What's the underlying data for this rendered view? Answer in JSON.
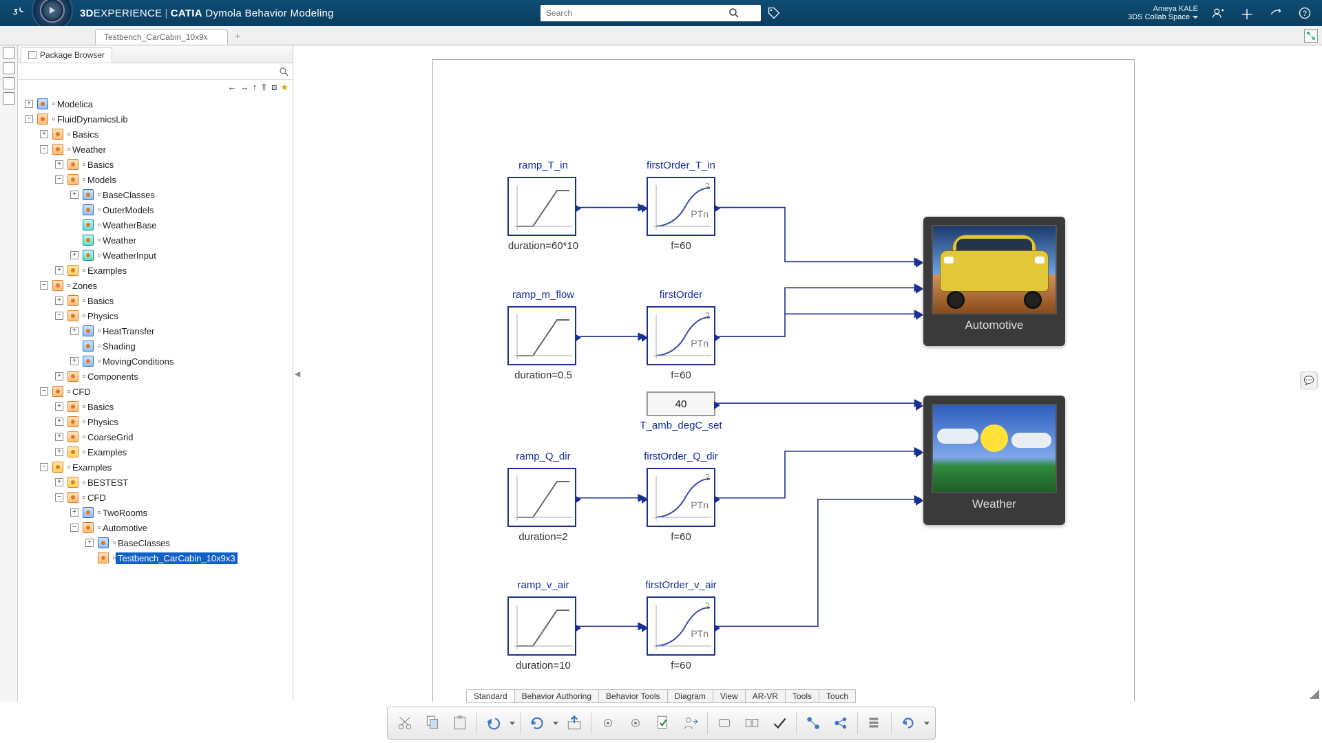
{
  "header": {
    "brand_prefix": "3D",
    "brand_main": "EXPERIENCE",
    "brand_product_bold": "CATIA",
    "brand_product_rest": " Dymola Behavior Modeling",
    "search_placeholder": "Search",
    "user_name": "Ameya KALE",
    "collab_space": "3DS Collab Space"
  },
  "tab": {
    "name": "Testbench_CarCabin_10x9x"
  },
  "sidebar": {
    "panel_title": "Package Browser",
    "root": "Modelica",
    "nodes": [
      {
        "d": 0,
        "e": "+",
        "i": "blue",
        "l": "Modelica",
        "head": true
      },
      {
        "d": 0,
        "e": "-",
        "i": "orange",
        "l": "FluidDynamicsLib"
      },
      {
        "d": 1,
        "e": "+",
        "i": "orange",
        "l": "Basics"
      },
      {
        "d": 1,
        "e": "-",
        "i": "orange",
        "l": "Weather"
      },
      {
        "d": 2,
        "e": "+",
        "i": "orange",
        "l": "Basics"
      },
      {
        "d": 2,
        "e": "-",
        "i": "orange",
        "l": "Models"
      },
      {
        "d": 3,
        "e": "+",
        "i": "blue",
        "l": "BaseClasses"
      },
      {
        "d": 3,
        "e": "",
        "i": "blue",
        "l": "OuterModels"
      },
      {
        "d": 3,
        "e": "",
        "i": "teal",
        "l": "WeatherBase"
      },
      {
        "d": 3,
        "e": "",
        "i": "teal",
        "l": "Weather"
      },
      {
        "d": 3,
        "e": "+",
        "i": "teal",
        "l": "WeatherInput"
      },
      {
        "d": 2,
        "e": "+",
        "i": "play",
        "l": "Examples"
      },
      {
        "d": 1,
        "e": "-",
        "i": "orange",
        "l": "Zones"
      },
      {
        "d": 2,
        "e": "+",
        "i": "orange",
        "l": "Basics"
      },
      {
        "d": 2,
        "e": "-",
        "i": "orange",
        "l": "Physics"
      },
      {
        "d": 3,
        "e": "+",
        "i": "blue",
        "l": "HeatTransfer"
      },
      {
        "d": 3,
        "e": "",
        "i": "blue",
        "l": "Shading"
      },
      {
        "d": 3,
        "e": "+",
        "i": "blue",
        "l": "MovingConditions"
      },
      {
        "d": 2,
        "e": "+",
        "i": "orange",
        "l": "Components"
      },
      {
        "d": 1,
        "e": "-",
        "i": "orange",
        "l": "CFD"
      },
      {
        "d": 2,
        "e": "+",
        "i": "orange",
        "l": "Basics"
      },
      {
        "d": 2,
        "e": "+",
        "i": "orange",
        "l": "Physics"
      },
      {
        "d": 2,
        "e": "+",
        "i": "orange",
        "l": "CoarseGrid"
      },
      {
        "d": 2,
        "e": "+",
        "i": "play",
        "l": "Examples"
      },
      {
        "d": 1,
        "e": "-",
        "i": "play",
        "l": "Examples"
      },
      {
        "d": 2,
        "e": "+",
        "i": "play",
        "l": "BESTEST"
      },
      {
        "d": 2,
        "e": "-",
        "i": "orange",
        "l": "CFD"
      },
      {
        "d": 3,
        "e": "+",
        "i": "blue",
        "l": "TwoRooms"
      },
      {
        "d": 3,
        "e": "-",
        "i": "orange",
        "l": "Automotive"
      },
      {
        "d": 4,
        "e": "+",
        "i": "blue",
        "l": "BaseClasses"
      },
      {
        "d": 4,
        "e": "",
        "i": "orange",
        "l": "Testbench_CarCabin_10x9x3",
        "sel": true
      }
    ]
  },
  "diagram": {
    "blocks": {
      "ramp_T_in": {
        "label": "ramp_T_in",
        "below": "duration=60*10"
      },
      "fo_T_in": {
        "label": "firstOrder_T_in",
        "below": "f=60",
        "num": "2",
        "ptn": "PTn"
      },
      "ramp_m_flow": {
        "label": "ramp_m_flow",
        "below": "duration=0.5"
      },
      "firstOrder": {
        "label": "firstOrder",
        "below": "f=60",
        "num": "2",
        "ptn": "PTn"
      },
      "const": {
        "value": "40",
        "below": "T_amb_degC_set"
      },
      "ramp_Q_dir": {
        "label": "ramp_Q_dir",
        "below": "duration=2"
      },
      "fo_Q_dir": {
        "label": "firstOrder_Q_dir",
        "below": "f=60",
        "num": "2",
        "ptn": "PTn"
      },
      "ramp_v_air": {
        "label": "ramp_v_air",
        "below": "duration=10"
      },
      "fo_v_air": {
        "label": "firstOrder_v_air",
        "below": "f=60",
        "num": "2",
        "ptn": "PTn"
      },
      "automotive": {
        "caption": "Automotive"
      },
      "weather": {
        "caption": "Weather"
      }
    }
  },
  "bottom_tabs": [
    "Standard",
    "Behavior Authoring",
    "Behavior Tools",
    "Diagram",
    "View",
    "AR-VR",
    "Tools",
    "Touch"
  ],
  "bottom_tabs_active": 0,
  "toolbar_icons": [
    "cut",
    "copy",
    "paste",
    "sep",
    "undo",
    "drop",
    "sep",
    "refresh",
    "drop",
    "export",
    "sep",
    "gear1",
    "gear2",
    "check-doc",
    "person-arrow",
    "sep",
    "rect",
    "rect-split",
    "check",
    "sep",
    "flow1",
    "flow2",
    "sep",
    "stack",
    "sep",
    "cycle",
    "drop"
  ]
}
